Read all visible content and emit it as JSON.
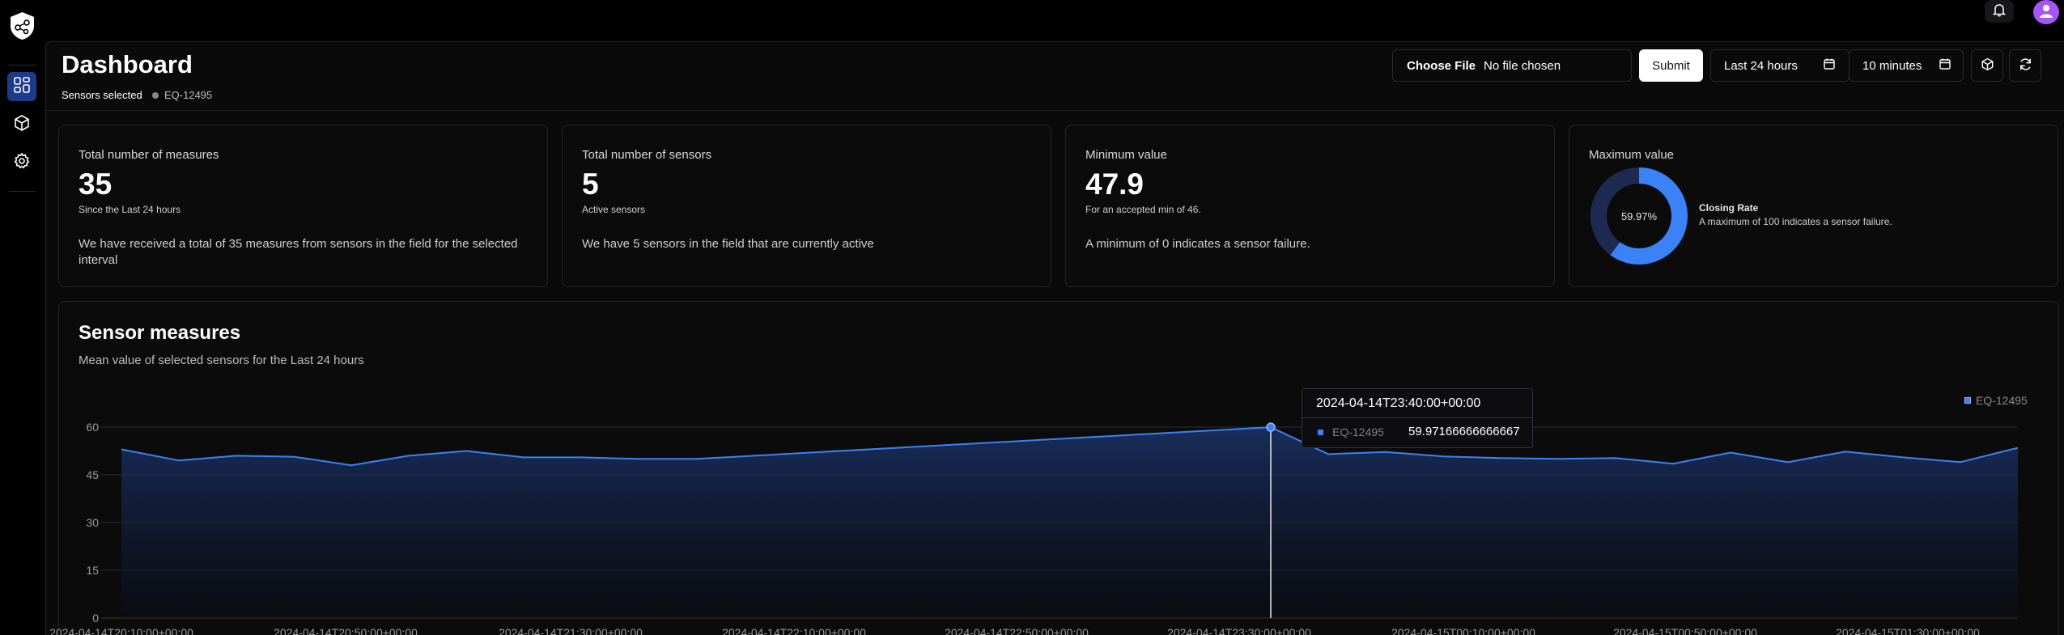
{
  "header": {
    "title": "Dashboard",
    "sensors_label": "Sensors selected",
    "selected_sensor": "EQ-12495",
    "file_button": "Choose File",
    "file_status": "No file chosen",
    "submit_label": "Submit",
    "time_range": "Last 24 hours",
    "refresh_interval": "10 minutes"
  },
  "cards": [
    {
      "key": "Total number of measures",
      "value": "35",
      "sub": "Since the Last 24 hours",
      "desc": "We have received a total of 35 measures from sensors in the field for the selected interval"
    },
    {
      "key": "Total number of sensors",
      "value": "5",
      "sub": "Active sensors",
      "desc": "We have 5 sensors in the field that are currently active"
    },
    {
      "key": "Minimum value",
      "value": "47.9",
      "sub": "For an accepted min of 46.",
      "desc": "A minimum of 0 indicates a sensor failure."
    },
    {
      "key": "Maximum value",
      "donut_label": "59.97%",
      "donut_fraction": 0.5997,
      "metric_title": "Closing Rate",
      "metric_desc": "A maximum of 100 indicates a sensor failure."
    }
  ],
  "panel": {
    "title": "Sensor measures",
    "subtitle": "Mean value of selected sensors for the Last 24 hours"
  },
  "tooltip": {
    "time": "2024-04-14T23:40:00+00:00",
    "series": "EQ-12495",
    "value": "59.97166666666667"
  },
  "colors": {
    "accent": "#3b82f6",
    "active_nav": "#1e3a8a",
    "avatar": "#a855f7",
    "donut_track": "#1e2a52"
  },
  "icons": [
    "bell-icon",
    "user-icon",
    "logo-icon",
    "dashboard-icon",
    "cube-icon",
    "gear-icon",
    "calendar-icon",
    "refresh-icon"
  ],
  "chart_data": {
    "type": "area",
    "series": [
      {
        "name": "EQ-12495",
        "values": [
          53,
          49.5,
          51,
          50.7,
          48,
          51,
          52.5,
          50.5,
          50.5,
          50,
          50,
          59.97,
          51.5,
          52.2,
          50.8,
          50.3,
          50,
          50.3,
          48.5,
          52,
          49,
          52.3,
          50.5,
          49,
          53.5
        ]
      }
    ],
    "x_ms_points": [
      0,
      10,
      20,
      30,
      40,
      50,
      60,
      70,
      80,
      90,
      100,
      200,
      210,
      220,
      230,
      240,
      250,
      260,
      270,
      280,
      290,
      300,
      310,
      320,
      330
    ],
    "x": [
      "2024-04-14T20:10:00+00:00",
      "2024-04-14T20:20:00+00:00",
      "2024-04-14T20:30:00+00:00",
      "2024-04-14T20:40:00+00:00",
      "2024-04-14T20:50:00+00:00",
      "2024-04-14T21:00:00+00:00",
      "2024-04-14T21:10:00+00:00",
      "2024-04-14T21:20:00+00:00",
      "2024-04-14T21:30:00+00:00",
      "2024-04-14T21:40:00+00:00",
      "2024-04-14T21:50:00+00:00",
      "2024-04-14T23:40:00+00:00",
      "2024-04-14T23:50:00+00:00",
      "2024-04-15T00:00:00+00:00",
      "2024-04-15T00:10:00+00:00",
      "2024-04-15T00:20:00+00:00",
      "2024-04-15T00:30:00+00:00",
      "2024-04-15T00:40:00+00:00",
      "2024-04-15T00:50:00+00:00",
      "2024-04-15T01:00:00+00:00",
      "2024-04-15T01:10:00+00:00",
      "2024-04-15T01:20:00+00:00",
      "2024-04-15T01:30:00+00:00",
      "2024-04-15T01:40:00+00:00",
      "2024-04-15T01:50:00+00:00"
    ],
    "x_tick_labels": [
      "2024-04-14T20:10:00+00:00",
      "2024-04-14T20:50:00+00:00",
      "2024-04-14T21:30:00+00:00",
      "2024-04-14T22:10:00+00:00",
      "2024-04-14T22:50:00+00:00",
      "2024-04-14T23:30:00+00:00",
      "2024-04-15T00:10:00+00:00",
      "2024-04-15T00:50:00+00:00",
      "2024-04-15T01:30:00+00:00"
    ],
    "y_ticks": [
      0,
      15,
      30,
      45,
      60
    ],
    "ylim": [
      0,
      60
    ],
    "highlight_index": 11,
    "legend": "top-right",
    "grid": true
  }
}
